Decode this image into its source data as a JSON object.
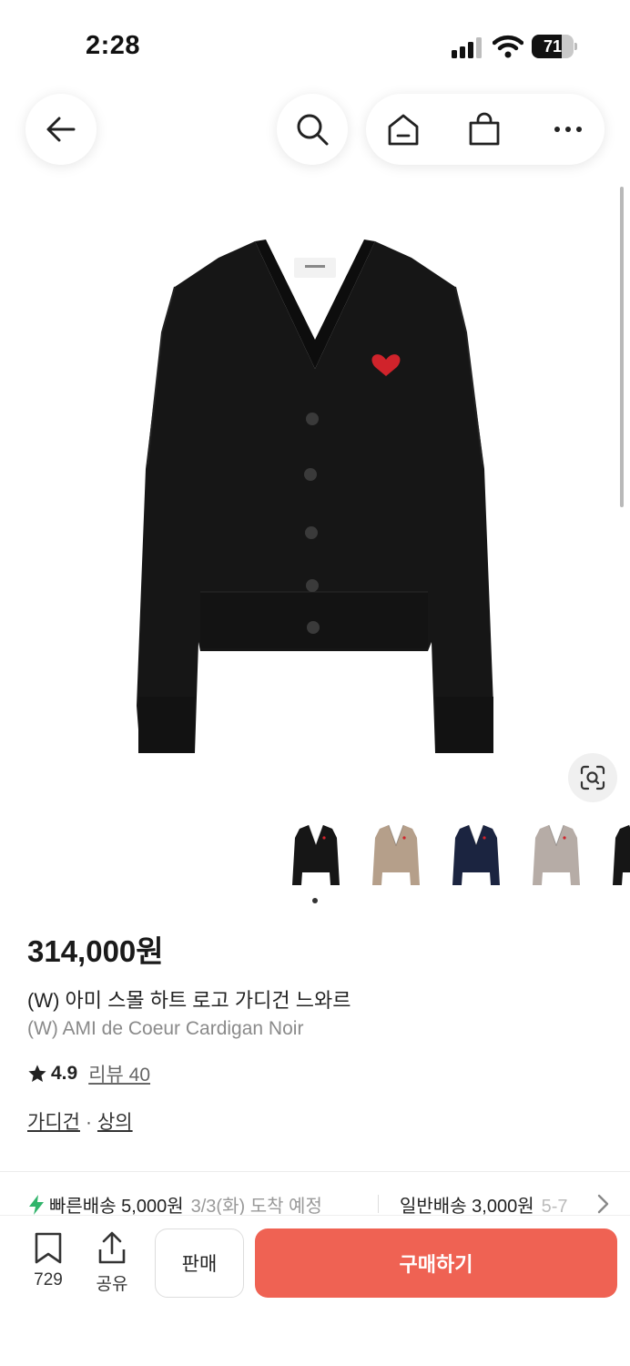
{
  "status_bar": {
    "time": "2:28",
    "battery": "71",
    "battery_level": 0.71
  },
  "nav": {
    "icons": [
      "arrow-left-icon",
      "search-icon",
      "home-icon",
      "shopping-bag-icon",
      "more-horizontal-icon"
    ]
  },
  "product": {
    "price": "314,000원",
    "title_ko": "(W) 아미 스몰 하트 로고 가디건 느와르",
    "title_en": "(W) AMI de Coeur Cardigan Noir",
    "rating": "4.9",
    "review_label": "리뷰 40",
    "categories": [
      "가디건",
      "상의"
    ],
    "category_separator": "·",
    "thumbnails": [
      {
        "color": "#161616"
      },
      {
        "color": "#b59f8a"
      },
      {
        "color": "#1b2440"
      },
      {
        "color": "#b6aca6"
      },
      {
        "color": "#161616"
      }
    ],
    "active_thumbnail": 1
  },
  "shipping": {
    "fast_label": "빠른배송 5,000원",
    "fast_eta": "3/3(화) 도착 예정",
    "normal_label": "일반배송 3,000원",
    "normal_eta": "5-7"
  },
  "bottom_bar": {
    "wishlist_count": "729",
    "share_label": "공유",
    "sell_label": "판매",
    "buy_label": "구매하기"
  },
  "colors": {
    "accent": "#ef6253",
    "fast_delivery": "#31b46b",
    "logo_heart": "#d0232b"
  }
}
